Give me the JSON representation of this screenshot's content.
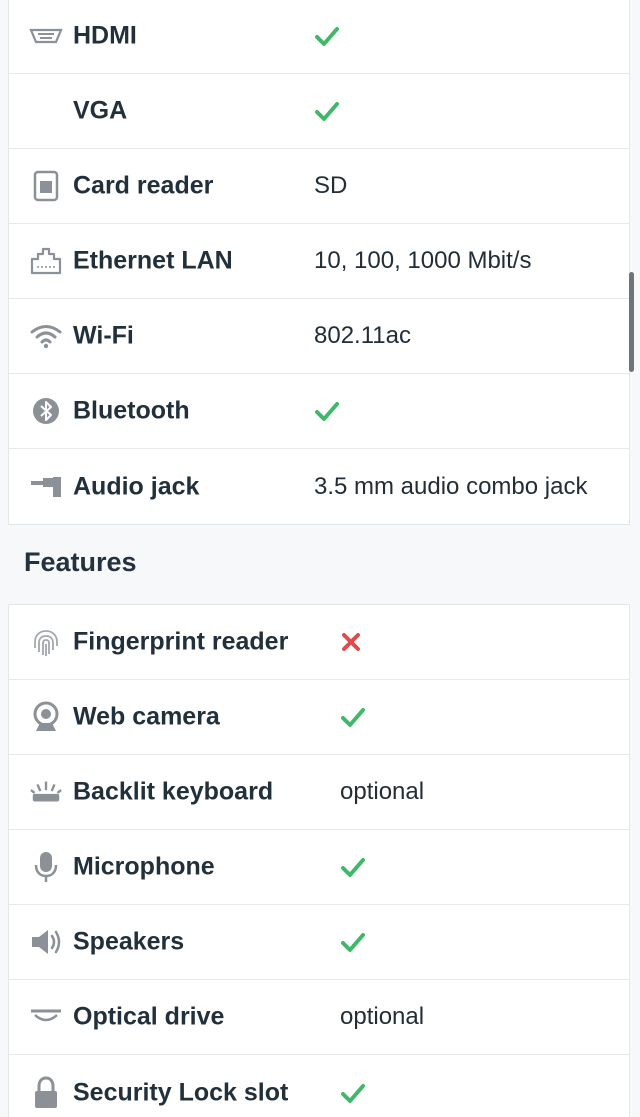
{
  "colors": {
    "check": "#3fb867",
    "cross": "#e04b4b",
    "icon": "#8b9197"
  },
  "connectivity": {
    "rows": [
      {
        "label": "HDMI",
        "icon": "hdmi-icon",
        "value": "",
        "status": "check"
      },
      {
        "label": "VGA",
        "icon": "",
        "value": "",
        "status": "check"
      },
      {
        "label": "Card reader",
        "icon": "sd-card-icon",
        "value": "SD",
        "status": ""
      },
      {
        "label": "Ethernet LAN",
        "icon": "ethernet-icon",
        "value": "10, 100, 1000 Mbit/s",
        "status": ""
      },
      {
        "label": "Wi-Fi",
        "icon": "wifi-icon",
        "value": "802.11ac",
        "status": ""
      },
      {
        "label": "Bluetooth",
        "icon": "bluetooth-icon",
        "value": "",
        "status": "check"
      },
      {
        "label": "Audio jack",
        "icon": "audio-jack-icon",
        "value": "3.5 mm audio combo jack",
        "status": ""
      }
    ]
  },
  "features": {
    "heading": "Features",
    "rows": [
      {
        "label": "Fingerprint reader",
        "icon": "fingerprint-icon",
        "value": "",
        "status": "cross"
      },
      {
        "label": "Web camera",
        "icon": "webcam-icon",
        "value": "",
        "status": "check"
      },
      {
        "label": "Backlit keyboard",
        "icon": "backlit-keyboard-icon",
        "value": "optional",
        "status": ""
      },
      {
        "label": "Microphone",
        "icon": "microphone-icon",
        "value": "",
        "status": "check"
      },
      {
        "label": "Speakers",
        "icon": "speaker-icon",
        "value": "",
        "status": "check"
      },
      {
        "label": "Optical drive",
        "icon": "optical-drive-icon",
        "value": "optional",
        "status": ""
      },
      {
        "label": "Security Lock slot",
        "icon": "lock-icon",
        "value": "",
        "status": "check"
      }
    ]
  }
}
